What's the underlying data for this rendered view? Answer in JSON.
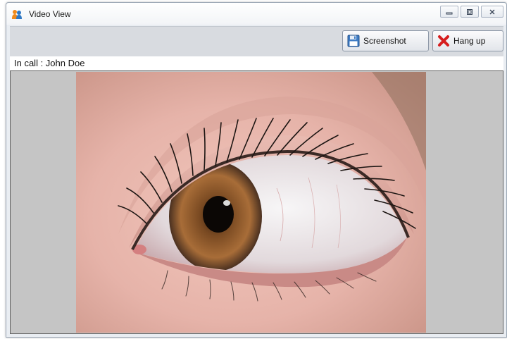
{
  "window": {
    "title": "Video View",
    "controls": {
      "minimize": "minimize",
      "maximize": "maximize",
      "close": "close"
    }
  },
  "toolbar": {
    "screenshot_label": "Screenshot",
    "hangup_label": "Hang up"
  },
  "status": {
    "text": "In call : John Doe"
  },
  "icons": {
    "app": "people-icon",
    "screenshot": "floppy-disk-icon",
    "hangup": "red-x-icon"
  },
  "colors": {
    "hangup_icon": "#d61d1d",
    "screenshot_icon": "#3f7cc4",
    "video_background": "#c5c5c5"
  }
}
